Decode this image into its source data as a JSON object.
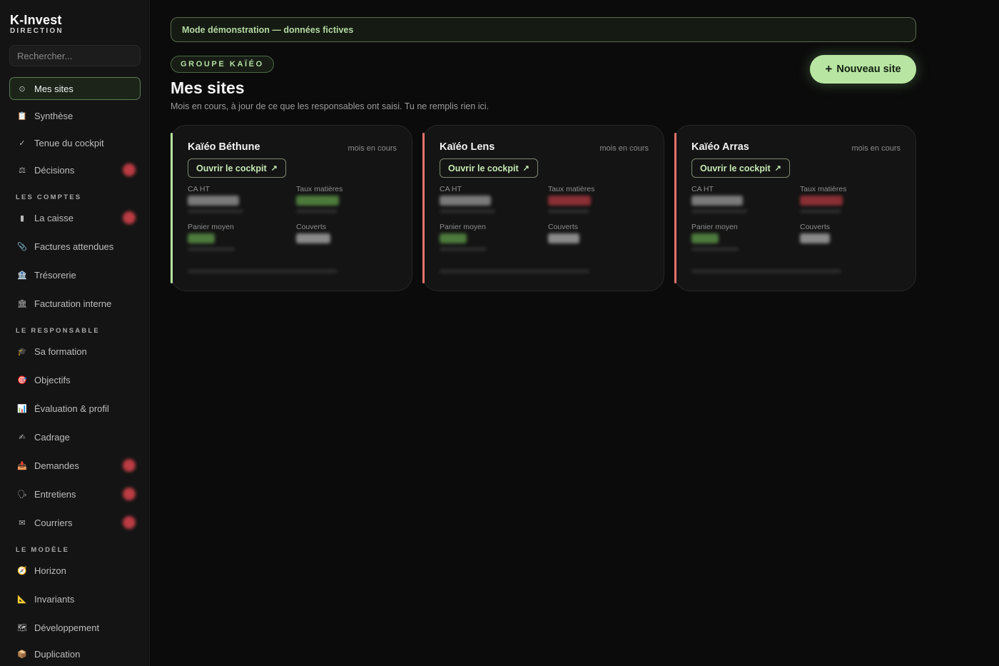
{
  "brand": {
    "name": "K-Invest",
    "subtitle": "DIRECTION"
  },
  "search": {
    "placeholder": "Rechercher..."
  },
  "nav": {
    "main": [
      {
        "label": "Mes sites",
        "icon": "home-icon",
        "glyph": "⊙",
        "active": true
      },
      {
        "label": "Synthèse",
        "icon": "clipboard-icon",
        "glyph": "📋"
      },
      {
        "label": "Tenue du cockpit",
        "icon": "check-icon",
        "glyph": "✓"
      },
      {
        "label": "Décisions",
        "icon": "scales-icon",
        "glyph": "⚖"
      }
    ],
    "sections": [
      {
        "title": "LES COMPTES",
        "items": [
          {
            "label": "La caisse",
            "icon": "cash-register-icon",
            "glyph": "▮"
          },
          {
            "label": "Factures attendues",
            "icon": "paperclip-icon",
            "glyph": "📎"
          },
          {
            "label": "Trésorerie",
            "icon": "bank-icon",
            "glyph": "🏦"
          },
          {
            "label": "Facturation interne",
            "icon": "building-icon",
            "glyph": "🏛"
          }
        ]
      },
      {
        "title": "LE RESPONSABLE",
        "items": [
          {
            "label": "Sa formation",
            "icon": "graduation-cap-icon",
            "glyph": "🎓"
          },
          {
            "label": "Objectifs",
            "icon": "target-icon",
            "glyph": "🎯"
          },
          {
            "label": "Évaluation & profil",
            "icon": "bar-chart-icon",
            "glyph": "📊"
          },
          {
            "label": "Cadrage",
            "icon": "handshake-icon",
            "glyph": "✍"
          },
          {
            "label": "Demandes",
            "icon": "inbox-icon",
            "glyph": "📥"
          },
          {
            "label": "Entretiens",
            "icon": "chat-icon",
            "glyph": "🗣"
          },
          {
            "label": "Courriers",
            "icon": "envelope-icon",
            "glyph": "✉"
          }
        ]
      },
      {
        "title": "LE MODÈLE",
        "items": [
          {
            "label": "Horizon",
            "icon": "compass-icon",
            "glyph": "🧭"
          },
          {
            "label": "Invariants",
            "icon": "ruler-triangle-icon",
            "glyph": "📐"
          },
          {
            "label": "Développement",
            "icon": "map-icon",
            "glyph": "🗺"
          },
          {
            "label": "Duplication",
            "icon": "package-icon",
            "glyph": "📦"
          }
        ]
      }
    ]
  },
  "banner": "Mode démonstration — données fictives",
  "group": "GROUPE KAÏÉO",
  "page": {
    "title": "Mes sites",
    "subtitle": "Mois en cours, à jour de ce que les responsables ont saisi. Tu ne remplis rien ici.",
    "new_button": "Nouveau site"
  },
  "cards": [
    {
      "name": "Kaïéo Béthune",
      "period": "mois en cours",
      "button": "Ouvrir le cockpit",
      "accent": "#b5e3a0",
      "labels": {
        "ca": "CA HT",
        "taux": "Taux matières",
        "panier": "Panier moyen",
        "couverts": "Couverts"
      },
      "status": {
        "taux": "#8ccf73"
      }
    },
    {
      "name": "Kaïéo Lens",
      "period": "mois en cours",
      "button": "Ouvrir le cockpit",
      "accent": "#e4736b",
      "labels": {
        "ca": "CA HT",
        "taux": "Taux matières",
        "panier": "Panier moyen",
        "couverts": "Couverts"
      },
      "status": {
        "taux": "#d94a52"
      }
    },
    {
      "name": "Kaïéo Arras",
      "period": "mois en cours",
      "button": "Ouvrir le cockpit",
      "accent": "#e4736b",
      "labels": {
        "ca": "CA HT",
        "taux": "Taux matières",
        "panier": "Panier moyen",
        "couverts": "Couverts"
      },
      "status": {
        "taux": "#d94a52"
      }
    }
  ]
}
